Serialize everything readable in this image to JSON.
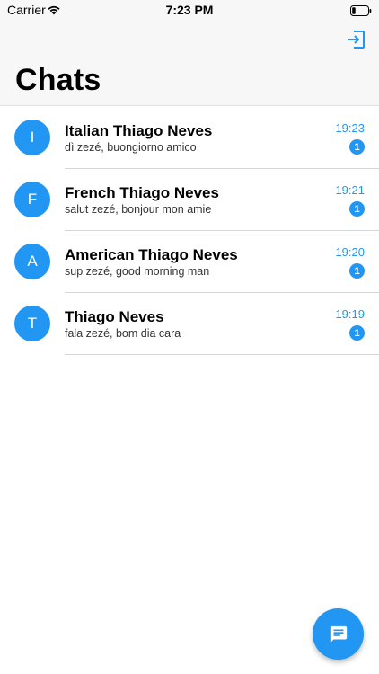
{
  "status_bar": {
    "carrier": "Carrier",
    "time": "7:23 PM"
  },
  "header": {
    "title": "Chats",
    "logout_icon": "logout-icon"
  },
  "colors": {
    "accent": "#2196f3",
    "header_bg": "#f7f7f7"
  },
  "chats": [
    {
      "initial": "I",
      "name": "Italian Thiago Neves",
      "preview": "dì zezé, buongiorno amico",
      "time": "19:23",
      "unread": "1"
    },
    {
      "initial": "F",
      "name": "French Thiago Neves",
      "preview": "salut zezé, bonjour mon amie",
      "time": "19:21",
      "unread": "1"
    },
    {
      "initial": "A",
      "name": "American Thiago Neves",
      "preview": "sup zezé, good morning man",
      "time": "19:20",
      "unread": "1"
    },
    {
      "initial": "T",
      "name": "Thiago Neves",
      "preview": "fala zezé, bom dia cara",
      "time": "19:19",
      "unread": "1"
    }
  ],
  "fab": {
    "icon": "new-message-icon"
  }
}
